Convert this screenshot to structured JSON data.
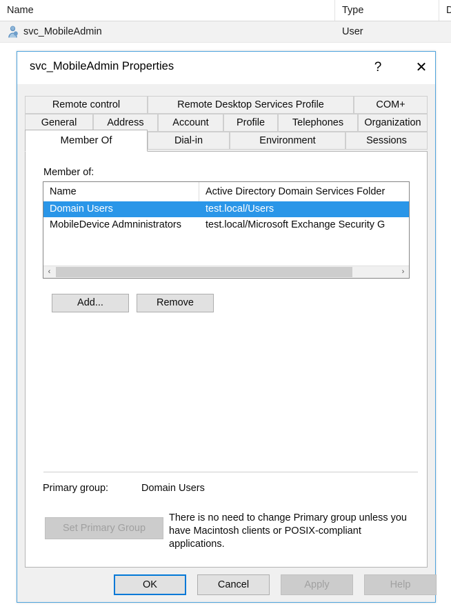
{
  "background_list": {
    "columns": [
      {
        "label": "Name"
      },
      {
        "label": "Type"
      },
      {
        "label": "D"
      }
    ],
    "rows": [
      {
        "name": "svc_MobileAdmin",
        "type": "User",
        "icon": "user-icon"
      }
    ]
  },
  "dialog": {
    "title": "svc_MobileAdmin Properties",
    "help_glyph": "?",
    "close_glyph": "✕",
    "tab_rows": [
      [
        {
          "label": "Remote control",
          "selected": false
        },
        {
          "label": "Remote Desktop Services Profile",
          "selected": false
        },
        {
          "label": "COM+",
          "selected": false
        }
      ],
      [
        {
          "label": "General",
          "selected": false
        },
        {
          "label": "Address",
          "selected": false
        },
        {
          "label": "Account",
          "selected": false
        },
        {
          "label": "Profile",
          "selected": false
        },
        {
          "label": "Telephones",
          "selected": false
        },
        {
          "label": "Organization",
          "selected": false
        }
      ],
      [
        {
          "label": "Member Of",
          "selected": true
        },
        {
          "label": "Dial-in",
          "selected": false
        },
        {
          "label": "Environment",
          "selected": false
        },
        {
          "label": "Sessions",
          "selected": false
        }
      ]
    ],
    "member_of": {
      "section_label": "Member of:",
      "columns": [
        {
          "label": "Name"
        },
        {
          "label": "Active Directory Domain Services Folder"
        }
      ],
      "rows": [
        {
          "name": "Domain Users",
          "folder": "test.local/Users",
          "selected": true
        },
        {
          "name": "MobileDevice Admninistrators",
          "folder": "test.local/Microsoft Exchange Security G",
          "selected": false
        }
      ],
      "scrollbar": {
        "left_glyph": "‹",
        "right_glyph": "›"
      },
      "add_label": "Add...",
      "remove_label": "Remove"
    },
    "primary_group": {
      "label": "Primary group:",
      "value": "Domain Users",
      "set_button_label": "Set Primary Group",
      "set_button_enabled": false,
      "note": "There is no need to change Primary group unless you have Macintosh clients or POSIX-compliant applications."
    },
    "buttons": {
      "ok": "OK",
      "cancel": "Cancel",
      "apply": "Apply",
      "help": "Help",
      "apply_enabled": false,
      "help_enabled": false
    }
  },
  "colors": {
    "selection_blue": "#2a96e8",
    "window_border": "#4da3dd",
    "default_button_outline": "#0078d7",
    "dialog_face": "#f0f0f0"
  }
}
